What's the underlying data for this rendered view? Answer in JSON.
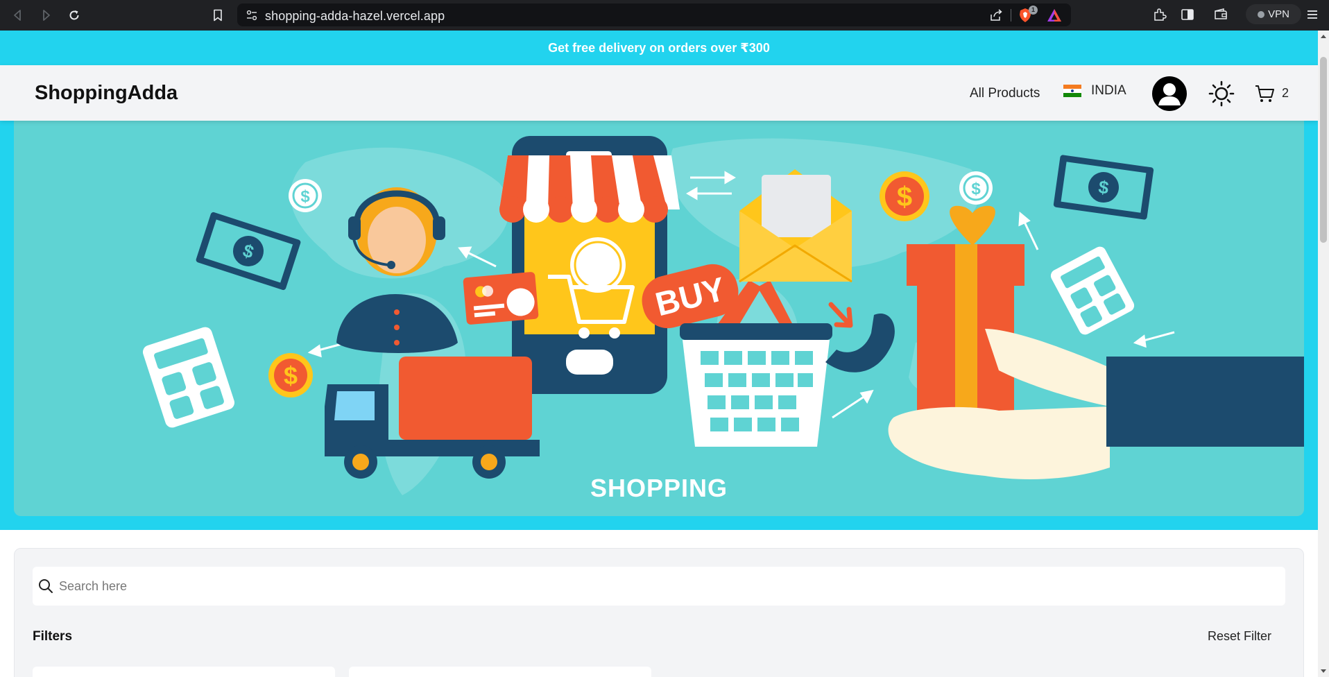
{
  "browser": {
    "url": "shopping-adda-hazel.vercel.app",
    "shield_badge": "1",
    "vpn_label": "VPN"
  },
  "promo": {
    "text": "Get free delivery on orders over ₹300"
  },
  "navbar": {
    "brand": "ShoppingAdda",
    "all_products": "All Products",
    "country": "INDIA",
    "cart_count": "2"
  },
  "hero": {
    "caption": "SHOPPING",
    "buy_label": "BUY"
  },
  "filters": {
    "search_placeholder": "Search here",
    "title": "Filters",
    "reset_label": "Reset Filter"
  },
  "colors": {
    "promo_bg": "#22d3ee",
    "navbar_bg": "#f3f4f6",
    "hero_bg": "#5fd3d3",
    "accent_orange": "#f15a31",
    "accent_yellow": "#ffc61b",
    "dark_navy": "#1c4b6e"
  },
  "icons": [
    "back-icon",
    "forward-icon",
    "reload-icon",
    "bookmark-icon",
    "site-settings-icon",
    "share-icon",
    "brave-shield-icon",
    "brave-rewards-icon",
    "extensions-icon",
    "sidebar-icon",
    "wallet-icon",
    "menu-icon",
    "user-icon",
    "sun-icon",
    "cart-icon",
    "search-icon"
  ]
}
